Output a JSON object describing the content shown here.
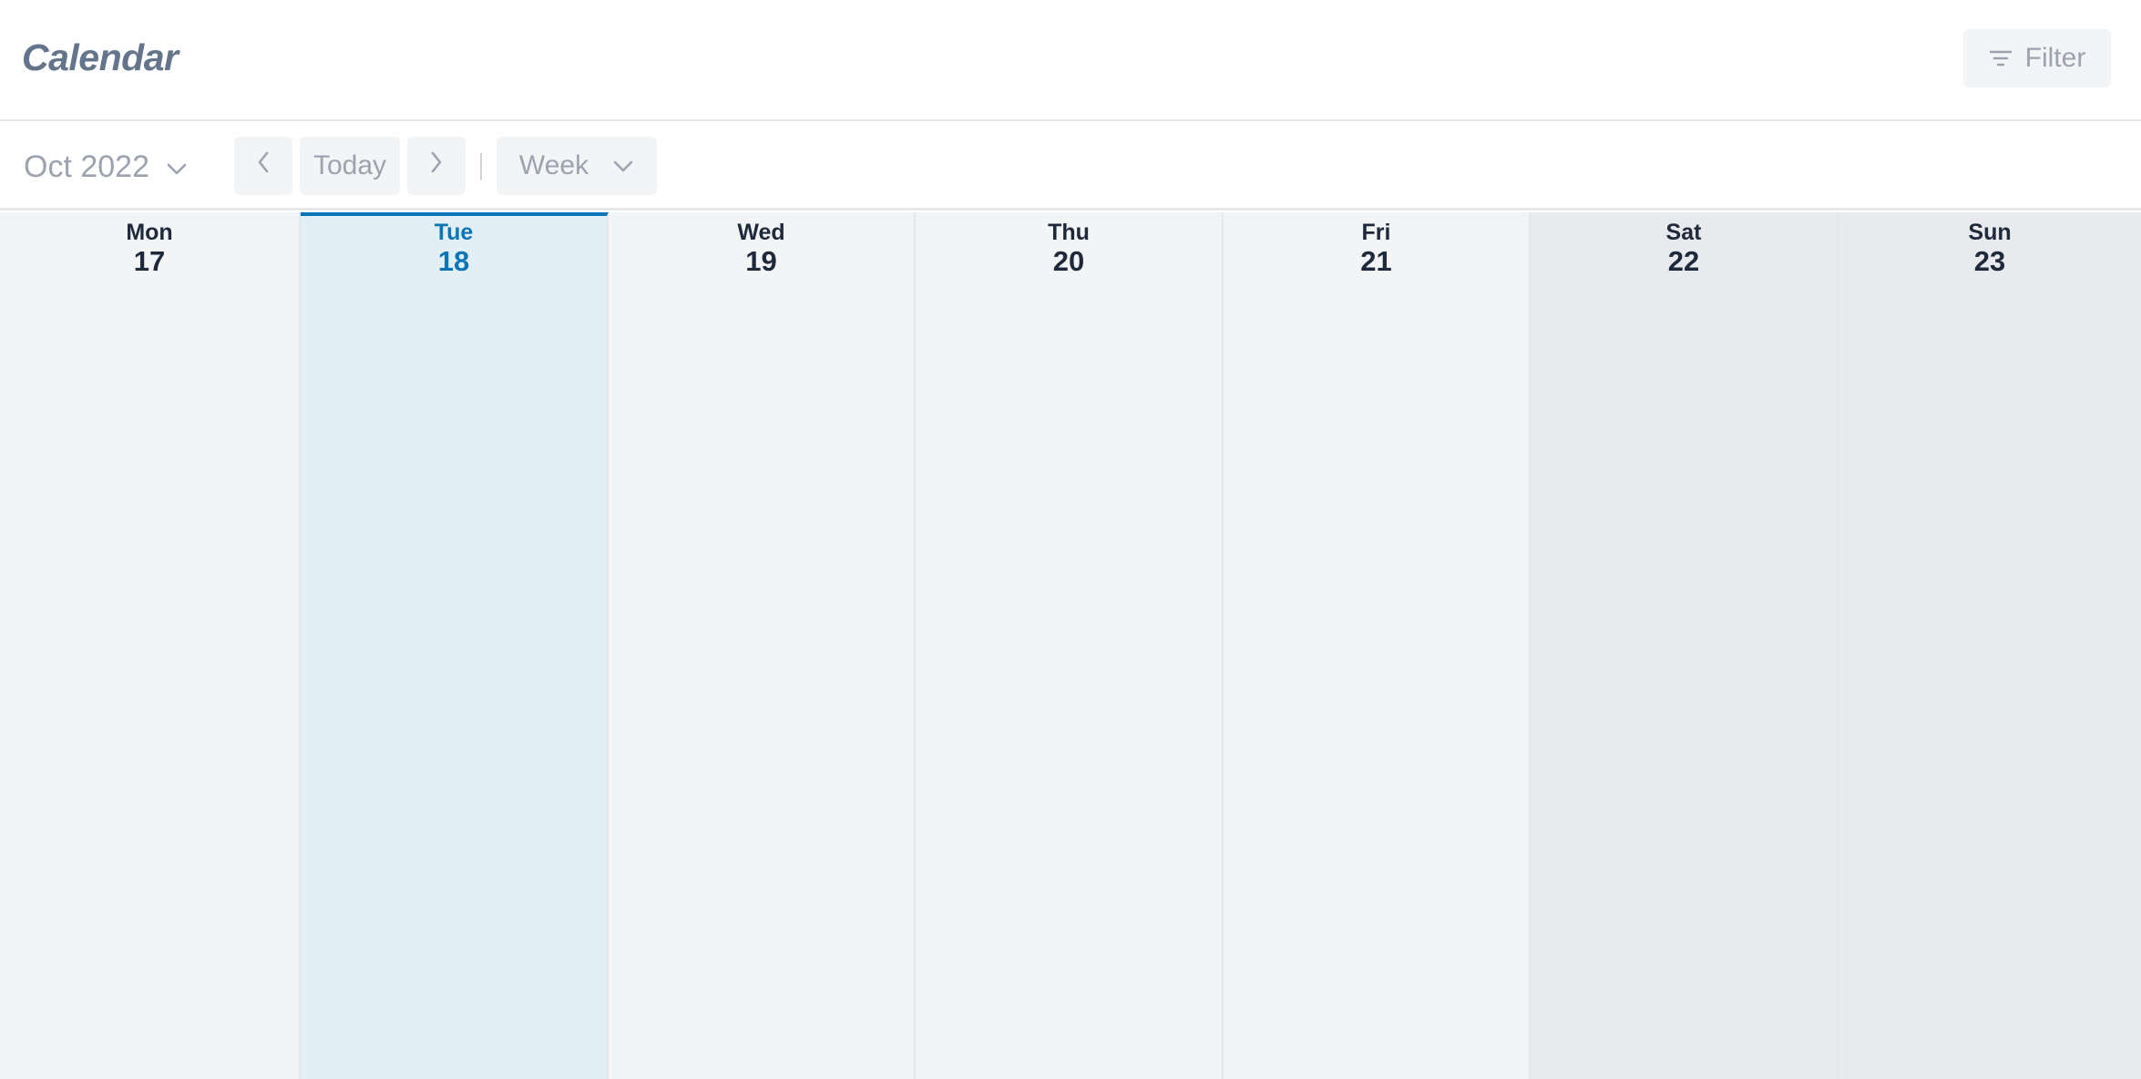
{
  "header": {
    "title": "Calendar",
    "filter_label": "Filter"
  },
  "toolbar": {
    "month_label": "Oct 2022",
    "today_label": "Today",
    "view_label": "Week"
  },
  "week": {
    "days": [
      {
        "name": "Mon",
        "date": "17"
      },
      {
        "name": "Tue",
        "date": "18"
      },
      {
        "name": "Wed",
        "date": "19"
      },
      {
        "name": "Thu",
        "date": "20"
      },
      {
        "name": "Fri",
        "date": "21"
      },
      {
        "name": "Sat",
        "date": "22"
      },
      {
        "name": "Sun",
        "date": "23"
      }
    ],
    "today_index": 1
  },
  "colors": {
    "accent": "#0c75b5",
    "today_bg": "#e2eff6",
    "weekday_bg": "#f3f4f6",
    "weekend_bg": "#e9eaee",
    "title": "#64748b",
    "muted": "#9ca3af"
  },
  "icons": {
    "filter": "filter-lines-icon",
    "month_dropdown": "chevron-down-icon",
    "prev": "chevron-left-icon",
    "next": "chevron-right-icon",
    "view_dropdown": "chevron-down-icon"
  }
}
